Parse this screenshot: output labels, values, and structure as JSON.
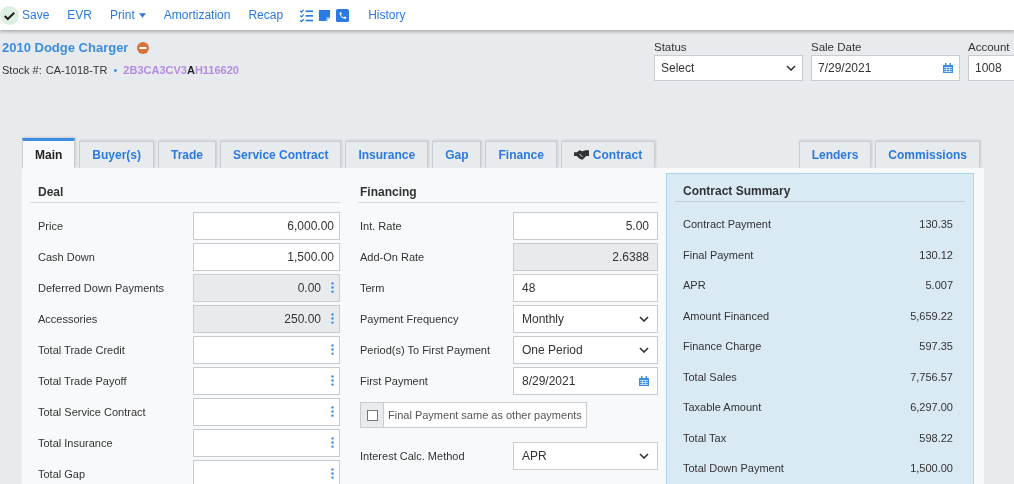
{
  "toolbar": {
    "save": "Save",
    "links": [
      {
        "kind": "link",
        "label": "EVR"
      },
      {
        "kind": "dropdown",
        "label": "Print"
      },
      {
        "kind": "link",
        "label": "Amortization"
      },
      {
        "kind": "link",
        "label": "Recap"
      }
    ],
    "history": "History"
  },
  "vehicle": {
    "title": "2010 Dodge Charger",
    "stock_label": "Stock #:",
    "stock": "CA-1018-TR",
    "separator": "•",
    "vin": [
      {
        "text": "2B3CA3CV3",
        "highlight": false
      },
      {
        "text": "A",
        "highlight": true
      },
      {
        "text": "H116620",
        "highlight": false
      }
    ]
  },
  "header_fields": [
    {
      "kind": "select",
      "label": "Status",
      "value": "Select"
    },
    {
      "kind": "date",
      "label": "Sale Date",
      "value": "7/29/2021"
    },
    {
      "kind": "text",
      "label": "Account",
      "value": "1008"
    }
  ],
  "tabs_left": [
    {
      "label": "Main",
      "selected": true,
      "kind": "plain"
    },
    {
      "label": "Buyer(s)",
      "selected": false,
      "kind": "plain"
    },
    {
      "label": "Trade",
      "selected": false,
      "kind": "plain"
    },
    {
      "label": "Service Contract",
      "selected": false,
      "kind": "plain"
    },
    {
      "label": "Insurance",
      "selected": false,
      "kind": "plain"
    },
    {
      "label": "Gap",
      "selected": false,
      "kind": "plain"
    },
    {
      "label": "Finance",
      "selected": false,
      "kind": "plain"
    },
    {
      "label": "Contract",
      "selected": false,
      "kind": "icon"
    }
  ],
  "tabs_right": [
    {
      "label": "Lenders",
      "selected": false
    },
    {
      "label": "Commissions",
      "selected": false
    }
  ],
  "deal": {
    "title": "Deal",
    "fields": [
      {
        "label": "Price",
        "value": "6,000.00",
        "readonly": false,
        "menu": false
      },
      {
        "label": "Cash Down",
        "value": "1,500.00",
        "readonly": false,
        "menu": false
      },
      {
        "label": "Deferred Down Payments",
        "value": "0.00",
        "readonly": true,
        "menu": true
      },
      {
        "label": "Accessories",
        "value": "250.00",
        "readonly": true,
        "menu": true
      },
      {
        "label": "Total Trade Credit",
        "readonly": false,
        "menu": true
      },
      {
        "label": "Total Trade Payoff",
        "readonly": false,
        "menu": true
      },
      {
        "label": "Total Service Contract",
        "readonly": false,
        "menu": true
      },
      {
        "label": "Total Insurance",
        "readonly": false,
        "menu": true
      },
      {
        "label": "Total Gap",
        "readonly": false,
        "menu": true
      }
    ]
  },
  "financing": {
    "title": "Financing",
    "fields": [
      {
        "kind": "number",
        "label": "Int. Rate",
        "value": "5.00"
      },
      {
        "kind": "readonly",
        "label": "Add-On Rate",
        "value": "2.6388"
      },
      {
        "kind": "text",
        "label": "Term",
        "value": "48"
      },
      {
        "kind": "select",
        "label": "Payment Frequency",
        "value": "Monthly"
      },
      {
        "kind": "select",
        "label": "Period(s) To First Payment",
        "value": "One Period"
      },
      {
        "kind": "date",
        "label": "First Payment",
        "value": "8/29/2021"
      },
      {
        "kind": "checkbox",
        "label": "Final Payment same as other payments",
        "checked": false
      },
      {
        "kind": "select",
        "label": "Interest Calc. Method",
        "value": "APR"
      }
    ]
  },
  "summary": {
    "title": "Contract Summary",
    "rows": [
      {
        "label": "Contract Payment",
        "value": "130.35"
      },
      {
        "label": "Final Payment",
        "value": "130.12"
      },
      {
        "label": "APR",
        "value": "5.007"
      },
      {
        "label": "Amount Financed",
        "value": "5,659.22"
      },
      {
        "label": "Finance Charge",
        "value": "597.35"
      },
      {
        "label": "Total Sales",
        "value": "7,756.57"
      },
      {
        "label": "Taxable Amount",
        "value": "6,297.00"
      },
      {
        "label": "Total Tax",
        "value": "598.22"
      },
      {
        "label": "Total Down Payment",
        "value": "1,500.00"
      }
    ]
  }
}
